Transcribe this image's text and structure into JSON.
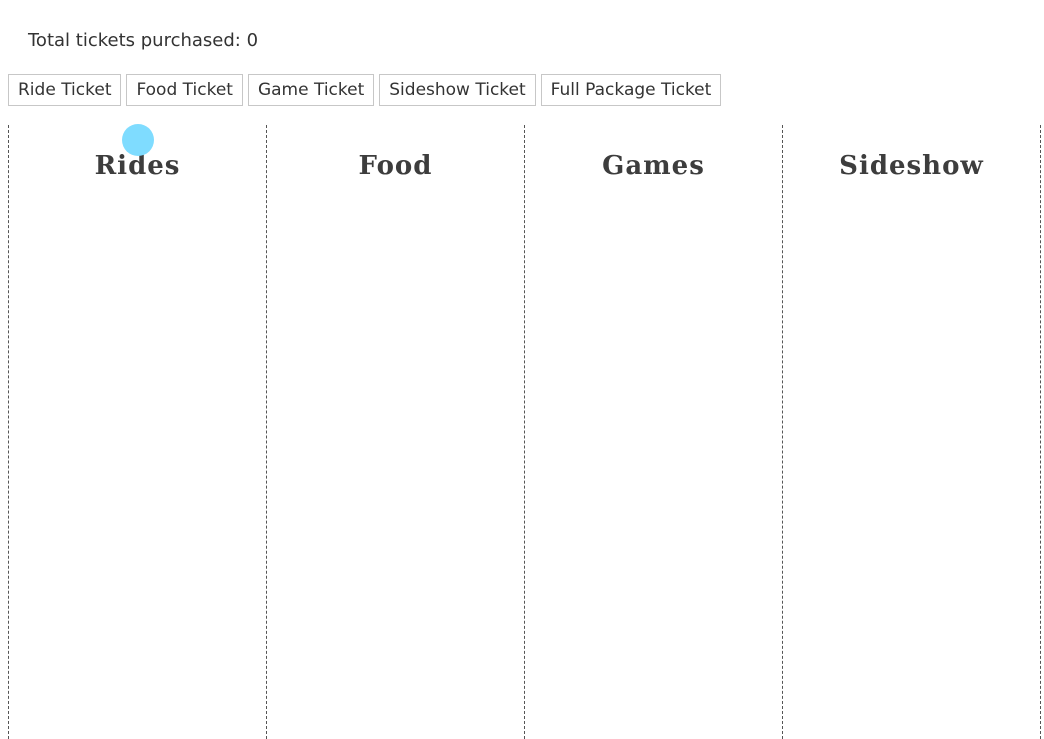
{
  "summary": {
    "label": "Total tickets purchased:",
    "count": "0"
  },
  "buttons": [
    {
      "label": "Ride Ticket"
    },
    {
      "label": "Food Ticket"
    },
    {
      "label": "Game Ticket"
    },
    {
      "label": "Sideshow Ticket"
    },
    {
      "label": "Full Package Ticket"
    }
  ],
  "columns": [
    {
      "title": "Rides"
    },
    {
      "title": "Food"
    },
    {
      "title": "Games"
    },
    {
      "title": "Sideshow"
    }
  ],
  "colors": {
    "cursor": "#7fdcff",
    "text": "#333333",
    "border": "#555555"
  }
}
